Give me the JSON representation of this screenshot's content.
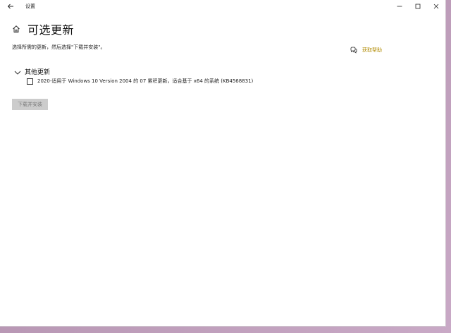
{
  "window": {
    "title": "设置"
  },
  "page": {
    "title": "可选更新",
    "instruction": "选择所需的更新，然后选择\"下载并安装\"。"
  },
  "help": {
    "icon": "chat-help-icon",
    "label": "获取帮助",
    "color": "#b08a00"
  },
  "section": {
    "title": "其他更新",
    "expanded": true
  },
  "updates": [
    {
      "label": "2020-适用于 Windows 10 Version 2004 的 07 累积更新，适合基于 x64 的系统 (KB4568831)",
      "checked": false
    }
  ],
  "actions": {
    "install_label": "下载并安装",
    "install_enabled": false
  }
}
